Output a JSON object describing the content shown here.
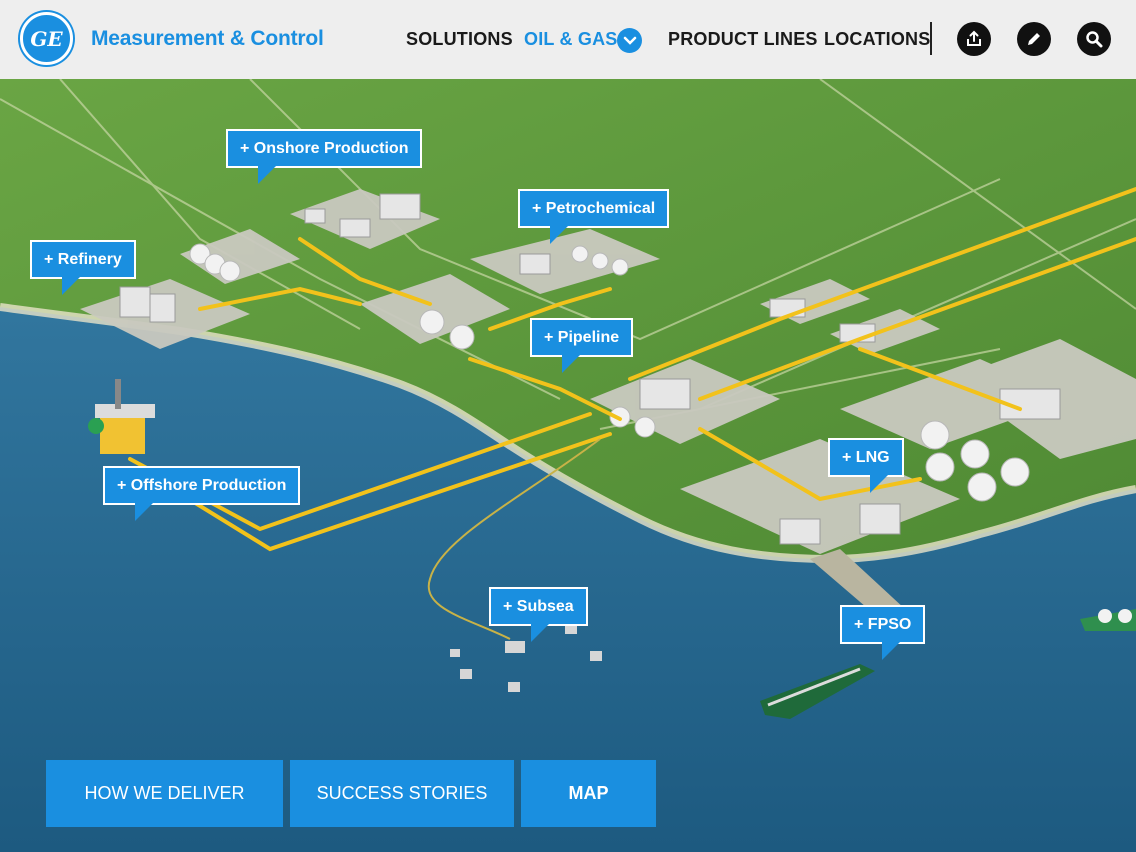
{
  "header": {
    "logo_text": "GE",
    "brand": "Measurement & Control",
    "nav": [
      {
        "label": "SOLUTIONS"
      },
      {
        "label": "OIL & GAS"
      },
      {
        "label": "PRODUCT LINES"
      },
      {
        "label": "LOCATIONS"
      }
    ],
    "icons": [
      "share-icon",
      "pencil-icon",
      "search-icon"
    ]
  },
  "callouts": {
    "onshore": "+ Onshore Production",
    "petrochemical": "+ Petrochemical",
    "refinery": "+ Refinery",
    "pipeline": "+ Pipeline",
    "offshore": "+ Offshore Production",
    "lng": "+ LNG",
    "subsea": "+ Subsea",
    "fpso": "+ FPSO"
  },
  "tabs": [
    {
      "label": "HOW WE DELIVER"
    },
    {
      "label": "SUCCESS STORIES"
    },
    {
      "label": "MAP"
    }
  ],
  "colors": {
    "accent": "#1a8fe0",
    "land": "#5f9a3c",
    "sea": "#2a6d95",
    "pipeline": "#f2c21b"
  }
}
